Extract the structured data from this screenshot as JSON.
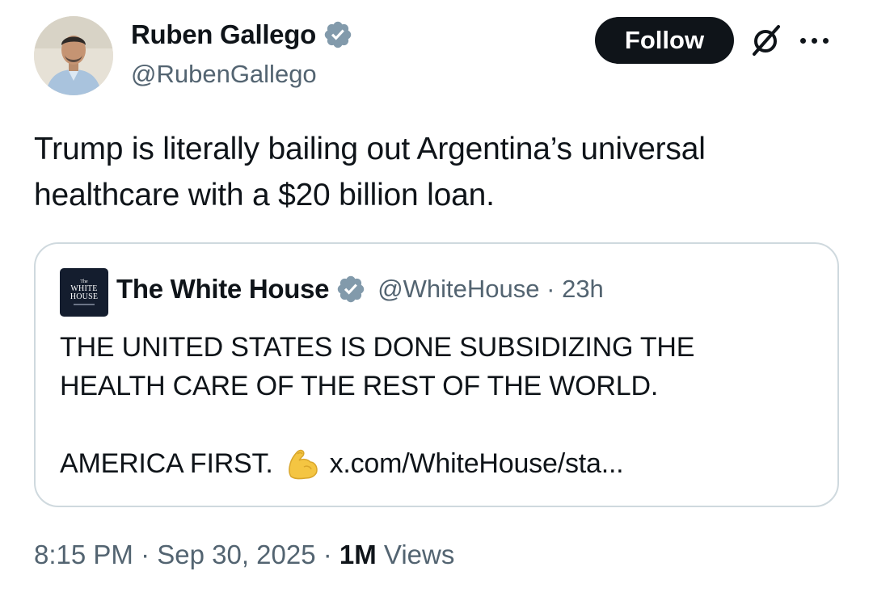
{
  "author": {
    "name": "Ruben Gallego",
    "handle": "@RubenGallego",
    "verified_icon": "verified-badge-icon",
    "badge_color": "#829aab"
  },
  "actions": {
    "follow_label": "Follow",
    "grok_icon": "grok-icon",
    "more_icon": "more-icon"
  },
  "tweet": {
    "text": "Trump is literally bailing out Argentina’s universal\nhealthcare with a $20 billion loan."
  },
  "quote": {
    "logo_text": {
      "line1": "The",
      "line2": "WHITE",
      "line3": "HOUSE"
    },
    "name": "The White House",
    "handle": "@WhiteHouse",
    "separator": " · ",
    "time": "23h",
    "text": "THE UNITED STATES IS DONE SUBSIDIZING THE\nHEALTH CARE OF THE REST OF THE WORLD.",
    "last_line": "AMERICA FIRST.",
    "emoji_icon": "flexed-biceps-icon",
    "link": "x.com/WhiteHouse/sta..."
  },
  "footer": {
    "time": "8:15 PM",
    "separator": " · ",
    "date": "Sep 30, 2025",
    "views_count": "1M",
    "views_label": "Views"
  },
  "colors": {
    "text": "#0f1419",
    "secondary": "#536471",
    "border": "#cfd9de",
    "follow_bg": "#0f1419"
  }
}
